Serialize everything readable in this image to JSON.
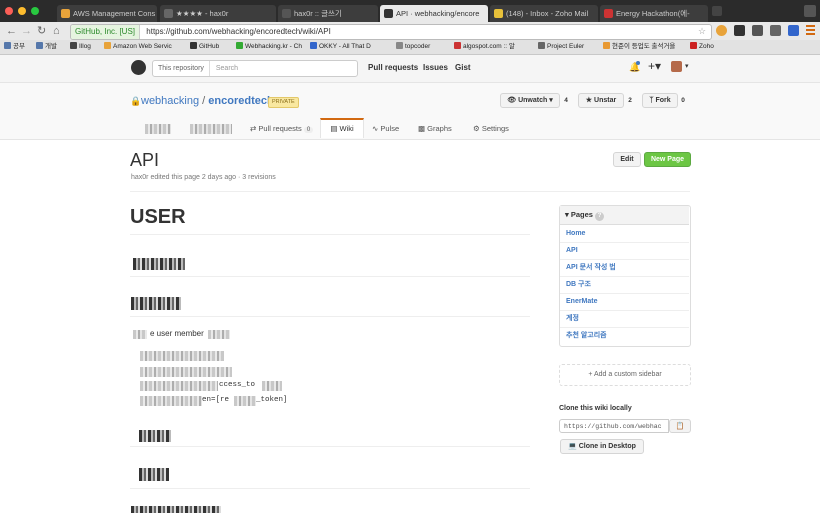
{
  "browser": {
    "tabs": [
      {
        "label": "AWS Management Cons",
        "favicon_color": "#e8a33a"
      },
      {
        "label": "★★★★ - hax0r",
        "favicon_color": "#666666"
      },
      {
        "label": "hax0r :: 글쓰기",
        "favicon_color": "#555555"
      },
      {
        "label": "API · webhacking/encore",
        "favicon_color": "#333333"
      },
      {
        "label": "(148) - Inbox - Zoho Mail",
        "favicon_color": "#e8c13a"
      },
      {
        "label": "Energy Hackathon(에-",
        "favicon_color": "#cc3333"
      }
    ],
    "url_identity": "GitHub, Inc. [US]",
    "url": "https://github.com/webhacking/encoredtech/wiki/API",
    "bookmarks": [
      {
        "label": "공부",
        "color": "#5577aa"
      },
      {
        "label": "개발",
        "color": "#5577aa"
      },
      {
        "label": "Illog",
        "color": "#444444"
      },
      {
        "label": "Amazon Web Servic",
        "color": "#e8a33a"
      },
      {
        "label": "GitHub",
        "color": "#333333"
      },
      {
        "label": "Webhacking.kr - Ch",
        "color": "#33aa33"
      },
      {
        "label": "OKKY - All That D",
        "color": "#3366cc"
      },
      {
        "label": "topcoder",
        "color": "#888888"
      },
      {
        "label": "algospot.com :: 알",
        "color": "#cc3333"
      },
      {
        "label": "Project Euler",
        "color": "#666666"
      },
      {
        "label": "현준이 등업도 출석거을",
        "color": "#e89933"
      },
      {
        "label": "Zoho",
        "color": "#cc2222"
      }
    ]
  },
  "github": {
    "search_scope": "This repository",
    "search_placeholder": "Search",
    "nav": [
      "Pull requests",
      "Issues",
      "Gist"
    ],
    "repo_owner": "webhacking",
    "repo_name": "encoredtech",
    "private_label": "PRIVATE",
    "unwatch_label": "Unwatch",
    "unwatch_count": "4",
    "unstar_label": "Unstar",
    "unstar_count": "2",
    "fork_label": "Fork",
    "fork_count": "0",
    "tabs": {
      "pull_requests": "Pull requests",
      "pull_requests_count": "0",
      "wiki": "Wiki",
      "pulse": "Pulse",
      "graphs": "Graphs",
      "settings": "Settings"
    }
  },
  "wiki": {
    "title": "API",
    "meta": "hax0r edited this page 2 days ago · 3 revisions",
    "edit_label": "Edit",
    "new_page_label": "New Page",
    "heading": "USER",
    "fragment_1": "e user member",
    "fragment_2": "ccess_to",
    "fragment_3": "en=[re",
    "fragment_4": "_token]"
  },
  "sidebar": {
    "pages_title": "Pages",
    "pages_count": "?",
    "pages": [
      "Home",
      "API",
      "API 문서 작성 법",
      "DB 구조",
      "EnerMate",
      "계정",
      "추천 알고리즘"
    ],
    "add_sidebar": "Add a custom sidebar",
    "clone_title": "Clone this wiki locally",
    "clone_url": "https://github.com/webhac",
    "clone_desktop": "Clone in Desktop"
  }
}
